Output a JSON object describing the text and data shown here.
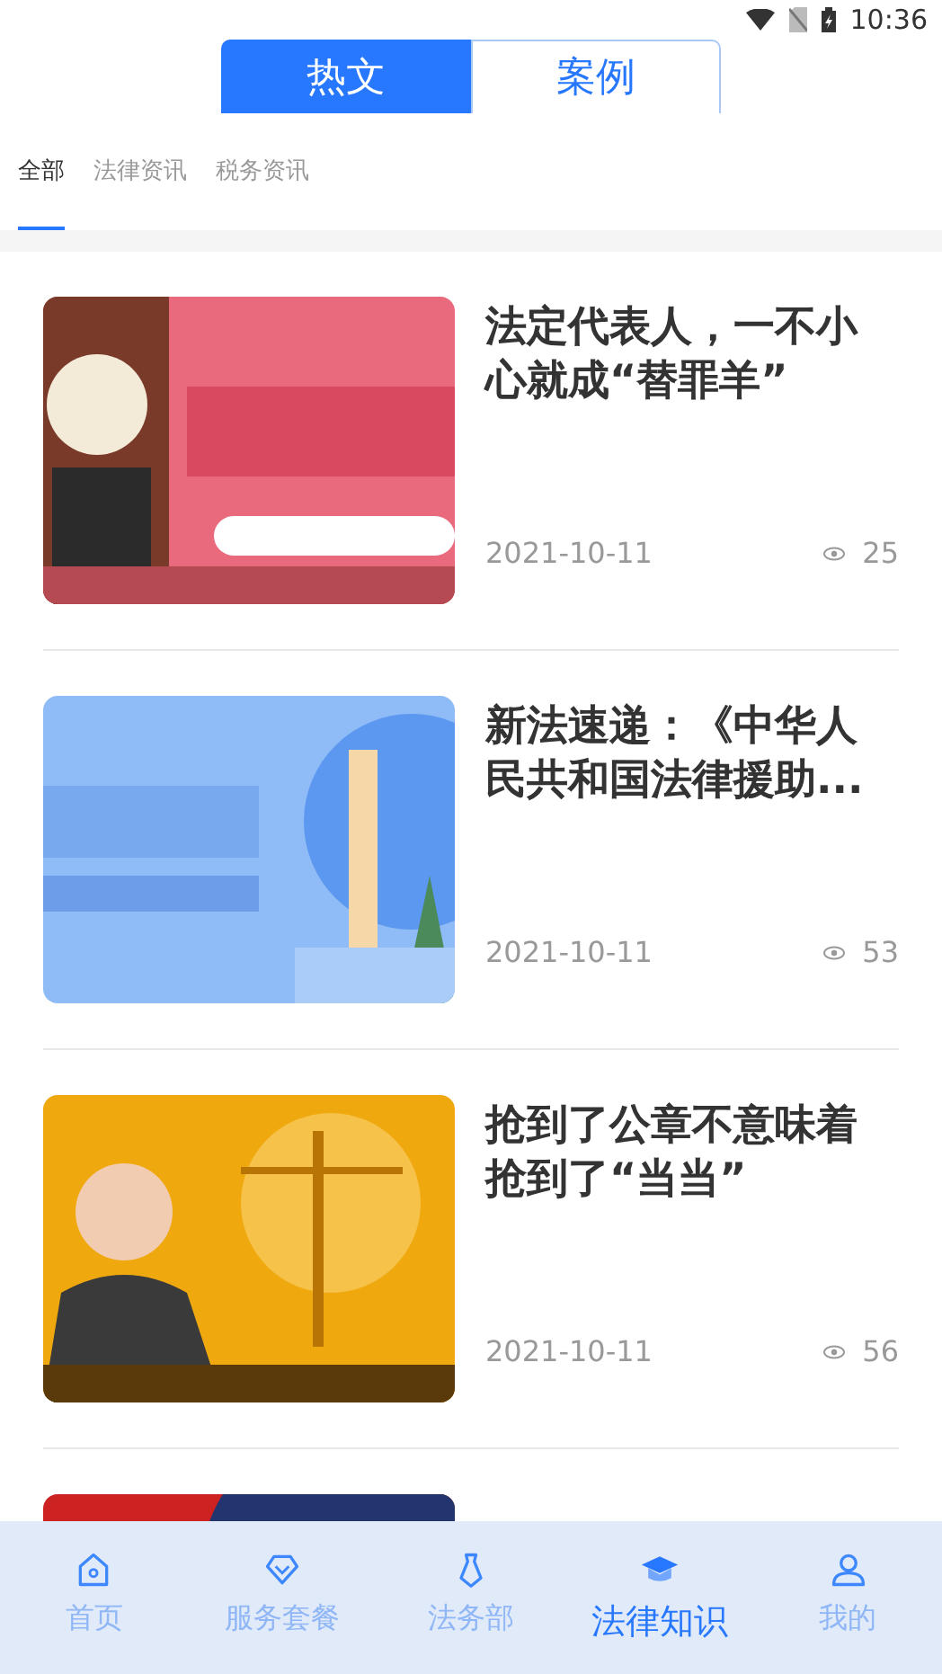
{
  "status_bar": {
    "time": "10:36"
  },
  "top_tabs": [
    {
      "label": "热文",
      "selected": true
    },
    {
      "label": "案例",
      "selected": false
    }
  ],
  "category_tabs": [
    {
      "label": "全部",
      "selected": true
    },
    {
      "label": "法律资讯",
      "selected": false
    },
    {
      "label": "税务资讯",
      "selected": false
    }
  ],
  "articles": [
    {
      "title": "法定代表人，一不小心就成“替罪羊”",
      "date": "2021-10-11",
      "views": "25",
      "picture": {
        "kind": "picture"
      }
    },
    {
      "title": "新法速递：《中华人民共和国法律援助...",
      "date": "2021-10-11",
      "views": "53",
      "picture": {
        "kind": "picture"
      }
    },
    {
      "title": "抢到了公章不意味着抢到了“当当”",
      "date": "2021-10-11",
      "views": "56",
      "picture": {
        "kind": "picture"
      }
    },
    {
      "picture": {
        "kind": "picture"
      }
    }
  ],
  "bottom_nav": [
    {
      "label": "首页",
      "selected": false
    },
    {
      "label": "服务套餐",
      "selected": false
    },
    {
      "label": "法务部",
      "selected": false
    },
    {
      "label": "法律知识",
      "selected": true
    },
    {
      "label": "我的",
      "selected": false
    }
  ]
}
